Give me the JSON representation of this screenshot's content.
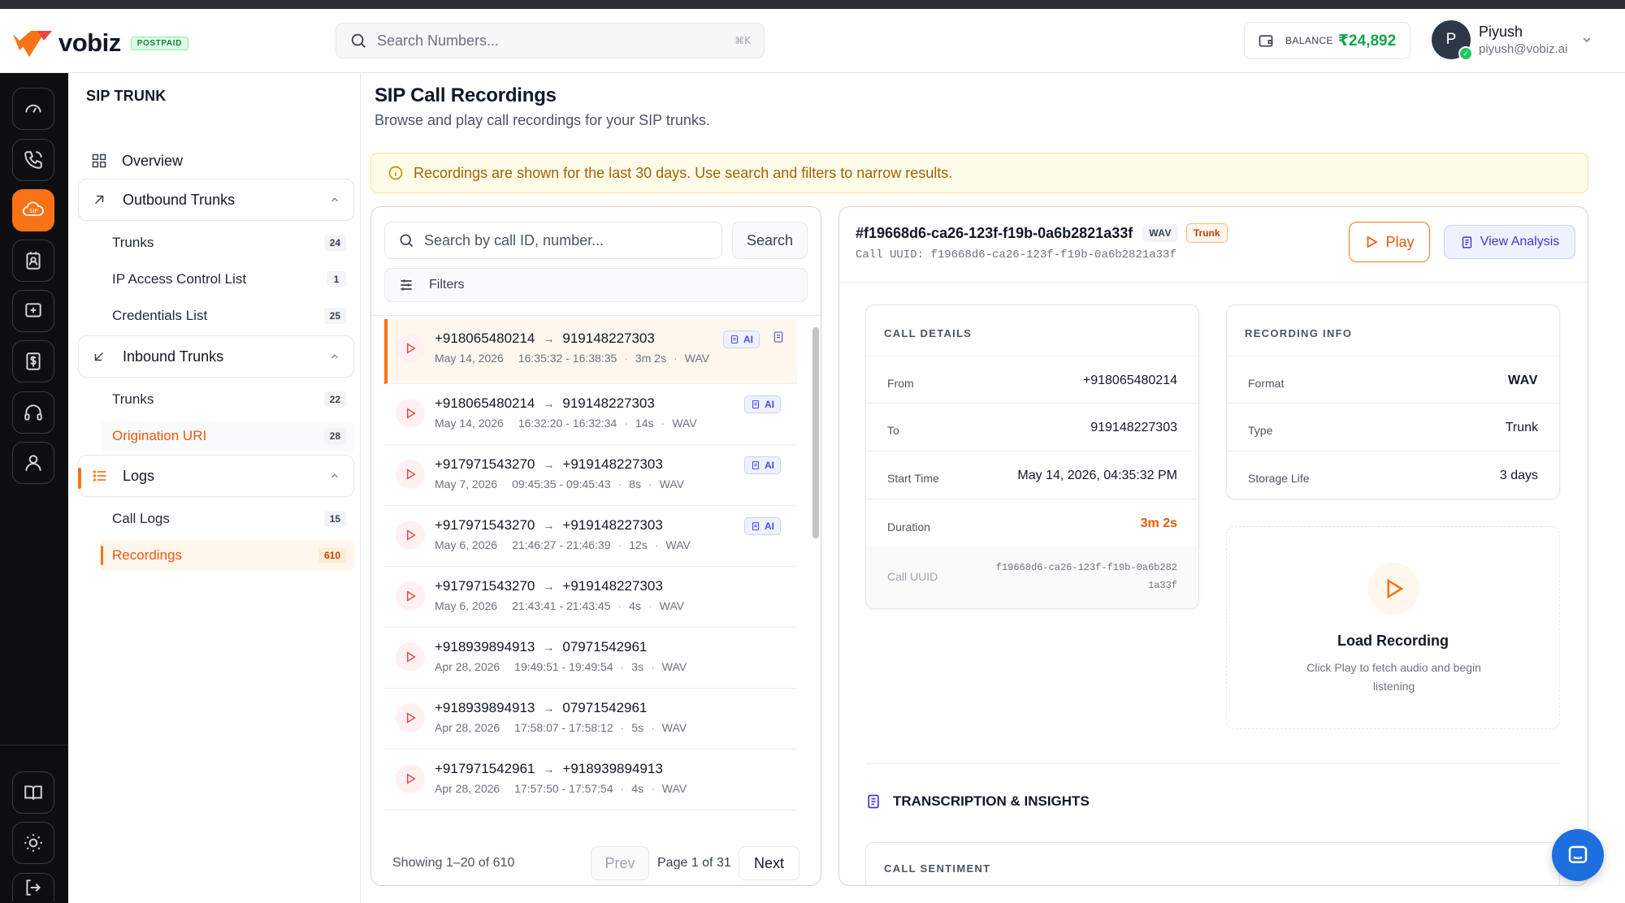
{
  "brand": {
    "name": "vobiz",
    "plan_badge": "POSTPAID",
    "accent": "#f97316"
  },
  "topbar": {
    "search_placeholder": "Search Numbers...",
    "search_shortcut": "⌘K",
    "balance_label": "BALANCE",
    "balance_value": "₹24,892",
    "user": {
      "initial": "P",
      "name": "Piyush",
      "email": "piyush@vobiz.ai"
    }
  },
  "rail": {
    "icons": [
      "dashboard-icon",
      "phone-icon",
      "sip-cloud-icon",
      "contact-card-icon",
      "message-plus-icon",
      "billing-icon",
      "headset-icon",
      "user-icon"
    ],
    "bottom_icons": [
      "book-icon",
      "sun-icon",
      "logout-icon"
    ]
  },
  "subnav": {
    "title": "SIP TRUNK",
    "overview": "Overview",
    "outbound": {
      "label": "Outbound Trunks",
      "items": [
        {
          "label": "Trunks",
          "count": "24"
        },
        {
          "label": "IP Access Control List",
          "count": "1"
        },
        {
          "label": "Credentials List",
          "count": "25"
        }
      ]
    },
    "inbound": {
      "label": "Inbound Trunks",
      "items": [
        {
          "label": "Trunks",
          "count": "22"
        },
        {
          "label": "Origination URI",
          "count": "28"
        }
      ]
    },
    "logs": {
      "label": "Logs",
      "items": [
        {
          "label": "Call Logs",
          "count": "15"
        },
        {
          "label": "Recordings",
          "count": "610"
        }
      ]
    }
  },
  "page": {
    "title": "SIP Call Recordings",
    "subtitle": "Browse and play call recordings for your SIP trunks.",
    "banner": "Recordings are shown for the last 30 days. Use search and filters to narrow results."
  },
  "list": {
    "search_placeholder": "Search by call ID, number...",
    "search_button": "Search",
    "filters_label": "Filters",
    "ai_label": "AI",
    "rows": [
      {
        "from": "+918065480214",
        "to": "919148227303",
        "date": "May 14, 2026",
        "time": "16:35:32 - 16:38:35",
        "duration": "3m 2s",
        "format": "WAV"
      },
      {
        "from": "+918065480214",
        "to": "919148227303",
        "date": "May 14, 2026",
        "time": "16:32:20 - 16:32:34",
        "duration": "14s",
        "format": "WAV"
      },
      {
        "from": "+917971543270",
        "to": "+919148227303",
        "date": "May 7, 2026",
        "time": "09:45:35 - 09:45:43",
        "duration": "8s",
        "format": "WAV"
      },
      {
        "from": "+917971543270",
        "to": "+919148227303",
        "date": "May 6, 2026",
        "time": "21:46:27 - 21:46:39",
        "duration": "12s",
        "format": "WAV"
      },
      {
        "from": "+917971543270",
        "to": "+919148227303",
        "date": "May 6, 2026",
        "time": "21:43:41 - 21:43:45",
        "duration": "4s",
        "format": "WAV"
      },
      {
        "from": "+918939894913",
        "to": "07971542961",
        "date": "Apr 28, 2026",
        "time": "19:49:51 - 19:49:54",
        "duration": "3s",
        "format": "WAV"
      },
      {
        "from": "+918939894913",
        "to": "07971542961",
        "date": "Apr 28, 2026",
        "time": "17:58:07 - 17:58:12",
        "duration": "5s",
        "format": "WAV"
      },
      {
        "from": "+917971542961",
        "to": "+918939894913",
        "date": "Apr 28, 2026",
        "time": "17:57:50 - 17:57:54",
        "duration": "4s",
        "format": "WAV"
      }
    ],
    "footer": {
      "showing": "Showing 1–20 of 610",
      "prev": "Prev",
      "page": "Page 1 of 31",
      "next": "Next"
    }
  },
  "detail": {
    "id": "#f19668d6-ca26-123f-f19b-0a6b2821a33f",
    "format_tag": "WAV",
    "type_tag": "Trunk",
    "uuid_line": "Call UUID: f19668d6-ca26-123f-f19b-0a6b2821a33f",
    "play_label": "Play",
    "analysis_label": "View Analysis",
    "call_details": {
      "title": "CALL DETAILS",
      "from_label": "From",
      "from_value": "+918065480214",
      "to_label": "To",
      "to_value": "919148227303",
      "start_label": "Start Time",
      "start_value": "May 14, 2026, 04:35:32 PM",
      "duration_label": "Duration",
      "duration_value": "3m 2s",
      "uuid_label": "Call UUID",
      "uuid_value": "f19668d6-ca26-123f-f19b-0a6b2821a33f"
    },
    "recording_info": {
      "title": "RECORDING INFO",
      "format_label": "Format",
      "format_value": "WAV",
      "type_label": "Type",
      "type_value": "Trunk",
      "storage_label": "Storage Life",
      "storage_value": "3 days"
    },
    "load": {
      "title": "Load Recording",
      "desc": "Click Play to fetch audio and begin listening"
    },
    "transcription_title": "TRANSCRIPTION & INSIGHTS",
    "sentiment_title": "CALL SENTIMENT"
  }
}
